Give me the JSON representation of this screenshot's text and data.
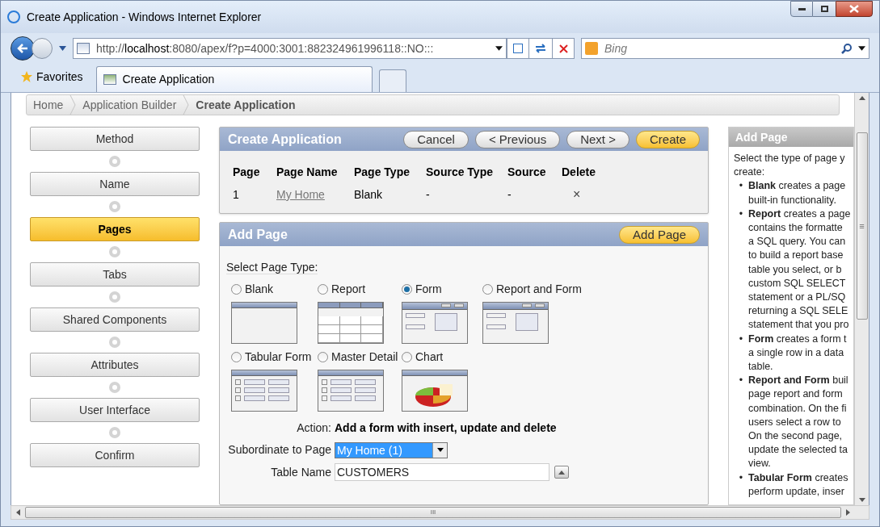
{
  "window": {
    "title": "Create Application - Windows Internet Explorer"
  },
  "address_bar": {
    "url_prefix": "http://",
    "url_host": "localhost",
    "url_rest": ":8080/apex/f?p=4000:3001:882324961996118::NO:::"
  },
  "search": {
    "placeholder": "Bing"
  },
  "favorites": {
    "label": "Favorites"
  },
  "tabs": [
    {
      "label": "Create Application",
      "selected": true
    }
  ],
  "breadcrumb": [
    {
      "label": "Home",
      "current": false
    },
    {
      "label": "Application Builder",
      "current": false
    },
    {
      "label": "Create Application",
      "current": true
    }
  ],
  "steps": [
    {
      "label": "Method",
      "selected": false
    },
    {
      "label": "Name",
      "selected": false
    },
    {
      "label": "Pages",
      "selected": true
    },
    {
      "label": "Tabs",
      "selected": false
    },
    {
      "label": "Shared Components",
      "selected": false
    },
    {
      "label": "Attributes",
      "selected": false
    },
    {
      "label": "User Interface",
      "selected": false
    },
    {
      "label": "Confirm",
      "selected": false
    }
  ],
  "create_panel": {
    "title": "Create Application",
    "buttons": [
      {
        "label": "Cancel",
        "primary": false
      },
      {
        "label": "< Previous",
        "primary": false
      },
      {
        "label": "Next >",
        "primary": false
      },
      {
        "label": "Create",
        "primary": true
      }
    ],
    "columns": [
      "Page",
      "Page Name",
      "Page Type",
      "Source Type",
      "Source",
      "Delete"
    ],
    "rows": [
      {
        "page": "1",
        "page_name": "My Home",
        "page_type": "Blank",
        "source_type": "-",
        "source": "-",
        "delete": "×"
      }
    ]
  },
  "add_page_panel": {
    "title": "Add Page",
    "button": "Add Page",
    "select_label": "Select Page Type:",
    "page_types": [
      {
        "label": "Blank",
        "kind": "blank",
        "selected": false
      },
      {
        "label": "Report",
        "kind": "report",
        "selected": false
      },
      {
        "label": "Form",
        "kind": "form",
        "selected": true
      },
      {
        "label": "Report and Form",
        "kind": "reportform",
        "selected": false
      },
      {
        "label": "Tabular Form",
        "kind": "tabular",
        "selected": false
      },
      {
        "label": "Master Detail",
        "kind": "master",
        "selected": false
      },
      {
        "label": "Chart",
        "kind": "chart",
        "selected": false
      }
    ],
    "action_label": "Action:",
    "action_value": "Add a form with insert, update and delete",
    "subordinate_label": "Subordinate to Page",
    "subordinate_value": "My Home (1)",
    "table_label": "Table Name",
    "table_value": "CUSTOMERS"
  },
  "help_panel": {
    "title": "Add Page",
    "intro": [
      "Select the type of page y",
      "create:"
    ],
    "items": [
      {
        "marker": "•",
        "lines": [
          "**Blank** creates a page",
          "built-in functionality."
        ]
      },
      {
        "marker": "•",
        "lines": [
          "**Report** creates a page",
          "contains the formatte",
          "a SQL query. You can",
          "to build a report base",
          "table you select, or b",
          "custom SQL SELECT",
          "statement or a PL/SQ",
          "returning a SQL SELE",
          "statement that you pro"
        ]
      },
      {
        "marker": "•",
        "lines": [
          "**Form** creates a form t",
          "a single row in a data",
          "table."
        ]
      },
      {
        "marker": "•",
        "lines": [
          "**Report and Form** buil",
          "page report and form",
          "combination. On the fi",
          "users select a row to",
          "On the second page,",
          "update the selected ta",
          "view."
        ]
      },
      {
        "marker": "•",
        "lines": [
          "**Tabular Form** creates",
          "perform update, inser"
        ]
      }
    ]
  },
  "scrollbar": {
    "grip": "≡",
    "hgrip": "III"
  }
}
